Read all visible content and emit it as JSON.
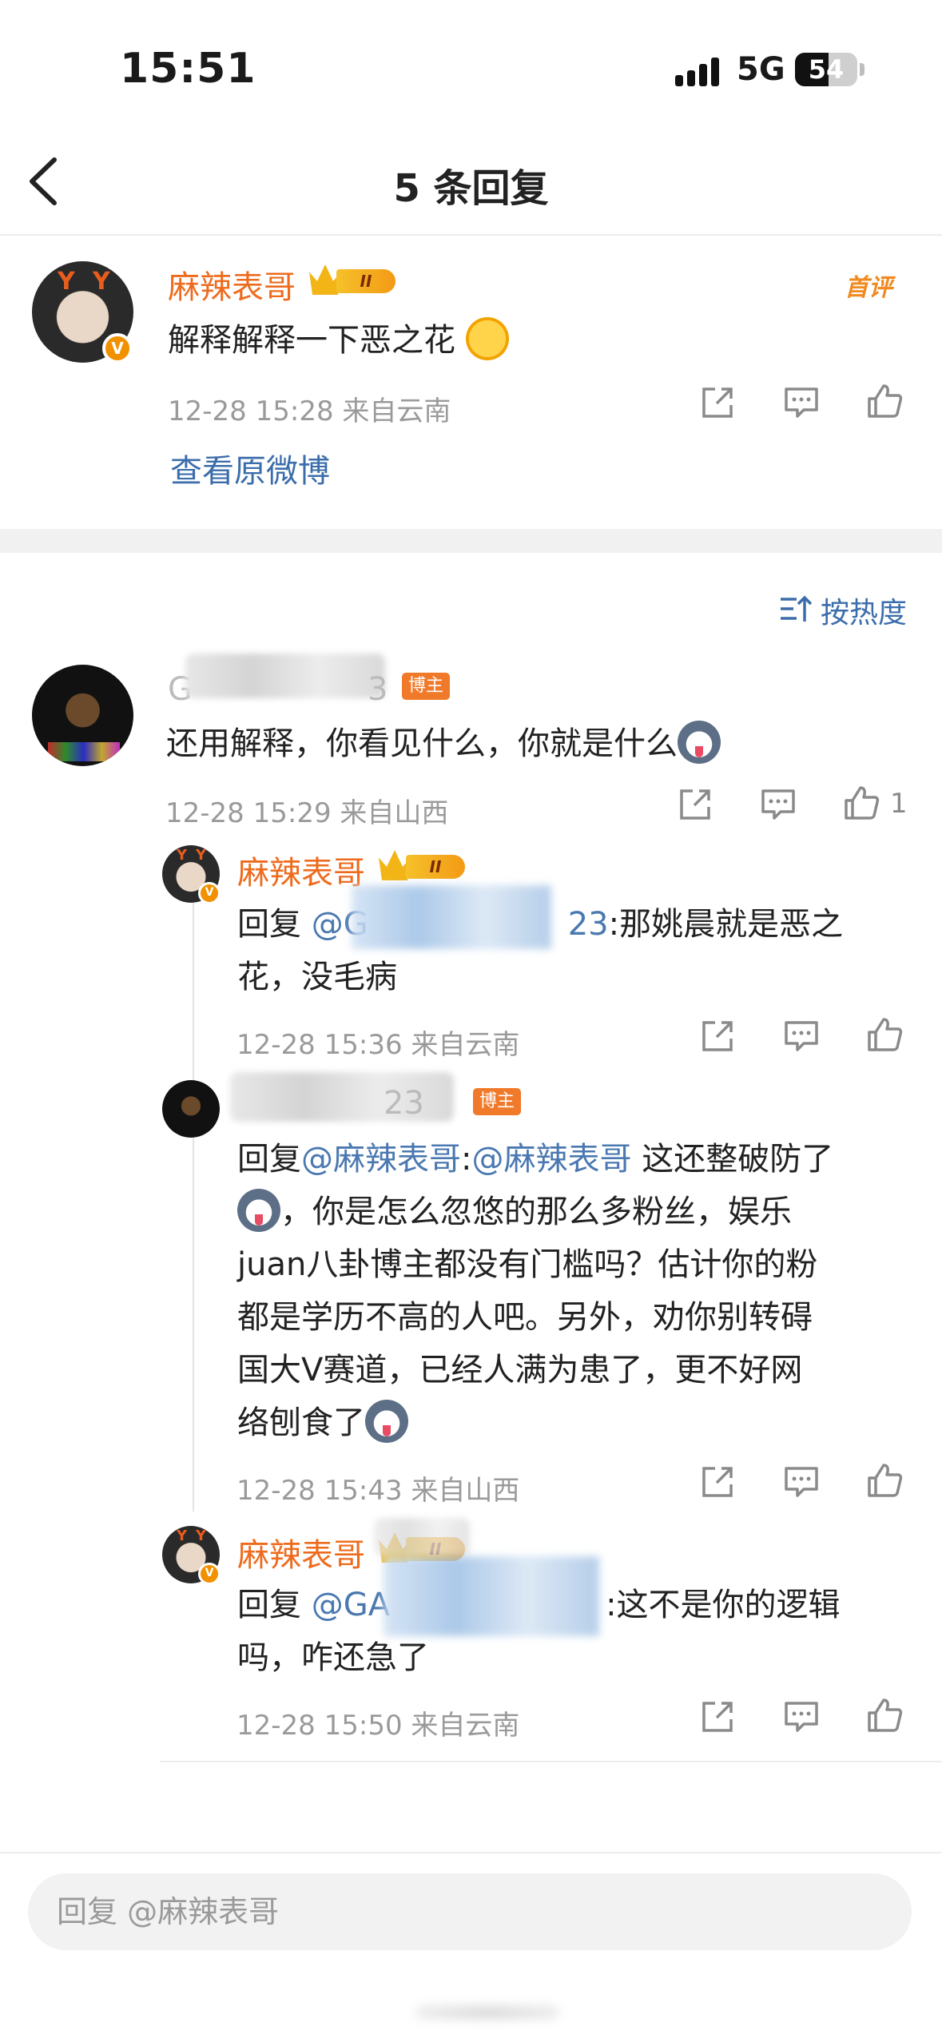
{
  "status_bar": {
    "time": "15:51",
    "network": "5G",
    "battery_level": "54",
    "battery_fraction": 0.54
  },
  "nav": {
    "title": "5 条回复"
  },
  "root": {
    "username": "麻辣表哥",
    "level_badge": "II",
    "hot_tag": "首评",
    "text": "解释解释一下恶之花",
    "meta": "12-28 15:28  来自云南",
    "view_original": "查看原微博"
  },
  "sort": {
    "label": "按热度"
  },
  "comments": [
    {
      "username_visible": "G",
      "username_suffix": "3",
      "author_tag": "博主",
      "text": "还用解释，你看见什么，你就是什么",
      "meta": "12-28 15:29  来自山西",
      "like_count": "1"
    }
  ],
  "replies": [
    {
      "username": "麻辣表哥",
      "level_badge": "II",
      "prefix": "回复 ",
      "mention": "@G",
      "mention_tail": "23",
      "text_a": ":那姚晨就是恶之",
      "text_b": "花，没毛病",
      "meta": "12-28 15:36  来自云南"
    },
    {
      "username_visible": "LA",
      "username_suffix": "23",
      "author_tag": "博主",
      "prefix": "回复",
      "mention_a": "@麻辣表哥",
      "colon": ":",
      "mention_b": "@麻辣表哥",
      "line1_tail": " 这还整破防了",
      "line2": "，你是怎么忽悠的那么多粉丝，娱乐",
      "line3": "juan八卦博主都没有门槛吗？估计你的粉",
      "line4": "都是学历不高的人吧。另外，劝你别转碍",
      "line5": "国大V赛道，已经人满为患了，更不好网",
      "line6": "络刨食了",
      "meta": "12-28 15:43  来自山西"
    },
    {
      "username": "麻辣表哥",
      "level_badge": "II",
      "prefix": "回复 ",
      "mention": "@GA",
      "text_a": ":这不是你的逻辑",
      "text_b": "吗，咋还急了",
      "meta": "12-28 15:50  来自云南"
    }
  ],
  "reply_bar": {
    "placeholder": "回复 @麻辣表哥"
  },
  "icons": [
    "chevron-left-icon",
    "share-icon",
    "comment-icon",
    "like-icon",
    "sort-icon"
  ],
  "colors": {
    "username": "#ee6b1d",
    "link": "#3b6dab",
    "author_tag": "#f07a2a",
    "verified": "#f29100"
  }
}
